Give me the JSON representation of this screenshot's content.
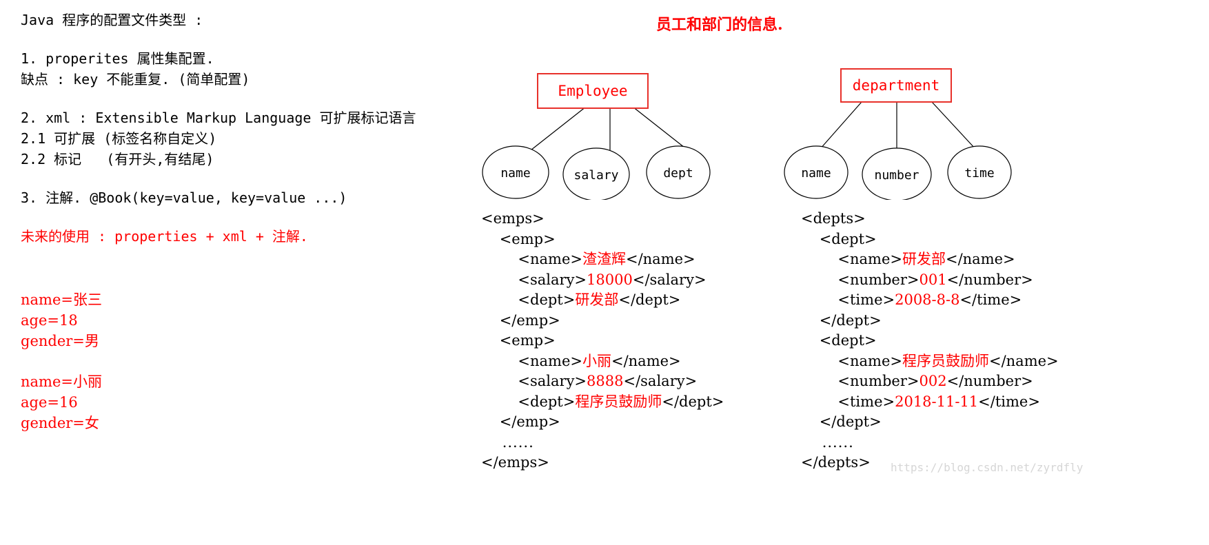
{
  "notes": {
    "heading": "Java 程序的配置文件类型 :",
    "sections": [
      {
        "text": "1. properites 属性集配置.",
        "color": "black"
      },
      {
        "text": "缺点 : key 不能重复. (简单配置)",
        "color": "black"
      },
      {
        "text": "2. xml : Extensible Markup Language 可扩展标记语言",
        "color": "black"
      },
      {
        "text": "2.1 可扩展 (标签名称自定义)",
        "color": "black"
      },
      {
        "text": "2.2 标记   (有开头,有结尾)",
        "color": "black"
      },
      {
        "text": "3. 注解. @Book(key=value, key=value ...)",
        "color": "black"
      },
      {
        "text": "未来的使用 : properties + xml + 注解.",
        "color": "red"
      }
    ]
  },
  "properties_sample": {
    "person1": [
      "name=张三",
      "age=18",
      "gender=男"
    ],
    "person2": [
      "name=小丽",
      "age=16",
      "gender=女"
    ]
  },
  "diagram": {
    "title": "员工和部门的信息.",
    "entities": [
      {
        "name": "Employee",
        "attributes": [
          "name",
          "salary",
          "dept"
        ]
      },
      {
        "name": "department",
        "attributes": [
          "name",
          "number",
          "time"
        ]
      }
    ]
  },
  "xml_emps": {
    "lines": [
      {
        "indent": 0,
        "open": "<emps>",
        "value": "",
        "close": ""
      },
      {
        "indent": 1,
        "open": "<emp>",
        "value": "",
        "close": ""
      },
      {
        "indent": 2,
        "open": "<name>",
        "value": "渣渣辉",
        "close": "</name>"
      },
      {
        "indent": 2,
        "open": "<salary>",
        "value": "18000",
        "close": "</salary>"
      },
      {
        "indent": 2,
        "open": "<dept>",
        "value": "研发部",
        "close": "</dept>"
      },
      {
        "indent": 1,
        "open": "</emp>",
        "value": "",
        "close": ""
      },
      {
        "indent": 1,
        "open": "<emp>",
        "value": "",
        "close": ""
      },
      {
        "indent": 2,
        "open": "<name>",
        "value": "小丽",
        "close": "</name>"
      },
      {
        "indent": 2,
        "open": "<salary>",
        "value": "8888",
        "close": "</salary>"
      },
      {
        "indent": 2,
        "open": "<dept>",
        "value": "程序员鼓励师",
        "close": "</dept>"
      },
      {
        "indent": 1,
        "open": "</emp>",
        "value": "",
        "close": ""
      },
      {
        "indent": 1,
        "open": "......",
        "value": "",
        "close": ""
      },
      {
        "indent": 0,
        "open": "</emps>",
        "value": "",
        "close": ""
      }
    ]
  },
  "xml_depts": {
    "lines": [
      {
        "indent": 0,
        "open": "<depts>",
        "value": "",
        "close": ""
      },
      {
        "indent": 1,
        "open": "<dept>",
        "value": "",
        "close": ""
      },
      {
        "indent": 2,
        "open": "<name>",
        "value": "研发部",
        "close": "</name>"
      },
      {
        "indent": 2,
        "open": "<number>",
        "value": "001",
        "close": "</number>"
      },
      {
        "indent": 2,
        "open": "<time>",
        "value": "2008-8-8",
        "close": "</time>"
      },
      {
        "indent": 1,
        "open": "</dept>",
        "value": "",
        "close": ""
      },
      {
        "indent": 1,
        "open": "<dept>",
        "value": "",
        "close": ""
      },
      {
        "indent": 2,
        "open": "<name>",
        "value": "程序员鼓励师",
        "close": "</name>"
      },
      {
        "indent": 2,
        "open": "<number>",
        "value": "002",
        "close": "</number>"
      },
      {
        "indent": 2,
        "open": "<time>",
        "value": "2018-11-11",
        "close": "</time>"
      },
      {
        "indent": 1,
        "open": "</dept>",
        "value": "",
        "close": ""
      },
      {
        "indent": 1,
        "open": "......",
        "value": "",
        "close": ""
      },
      {
        "indent": 0,
        "open": "</depts>",
        "value": "",
        "close": ""
      }
    ]
  },
  "watermark": {
    "text": "https://blog.csdn.net/zyrdfly"
  },
  "colors": {
    "accent_red": "#ff0000",
    "text_black": "#000000",
    "background": "#ffffff",
    "watermark_gray": "#d6d6d6"
  }
}
